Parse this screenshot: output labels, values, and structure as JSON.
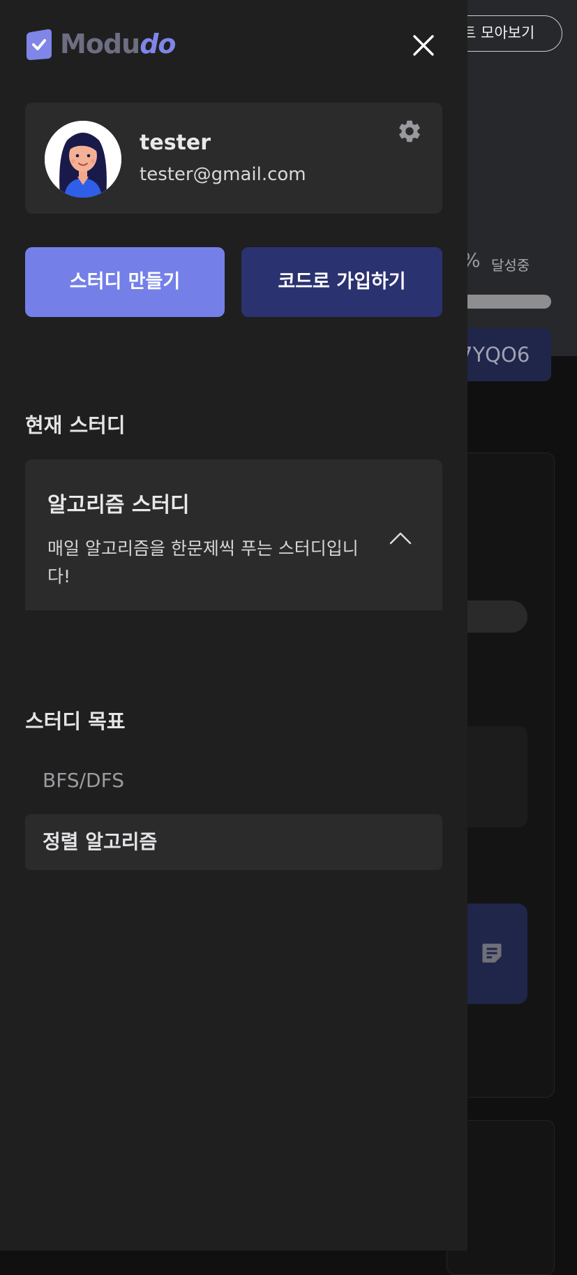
{
  "background": {
    "collection_button": "트 모아보기",
    "percent_symbol": "%",
    "achievement_label": "달성중",
    "invite_code_fragment": "7YQO6",
    "note_icon": "note-icon"
  },
  "drawer": {
    "logo": {
      "part1": "Modu",
      "part2": "do",
      "icon": "check-square-icon"
    },
    "close_icon": "close-icon",
    "profile": {
      "name": "tester",
      "email": "tester@gmail.com",
      "settings_icon": "gear-icon"
    },
    "buttons": {
      "create": "스터디 만들기",
      "join": "코드로 가입하기"
    },
    "current_study": {
      "heading": "현재 스터디",
      "name": "알고리즘 스터디",
      "description": "매일 알고리즘을 한문제씩 푸는 스터디입니다!",
      "toggle_icon": "chevron-up-icon"
    },
    "goals": {
      "heading": "스터디 목표",
      "items": [
        "BFS/DFS",
        "정렬 알고리즘"
      ]
    }
  },
  "colors": {
    "drawer_bg": "#1f1f1f",
    "card_bg": "#2b2b2c",
    "primary": "#7480e8",
    "primary_dark": "#2b3270"
  }
}
